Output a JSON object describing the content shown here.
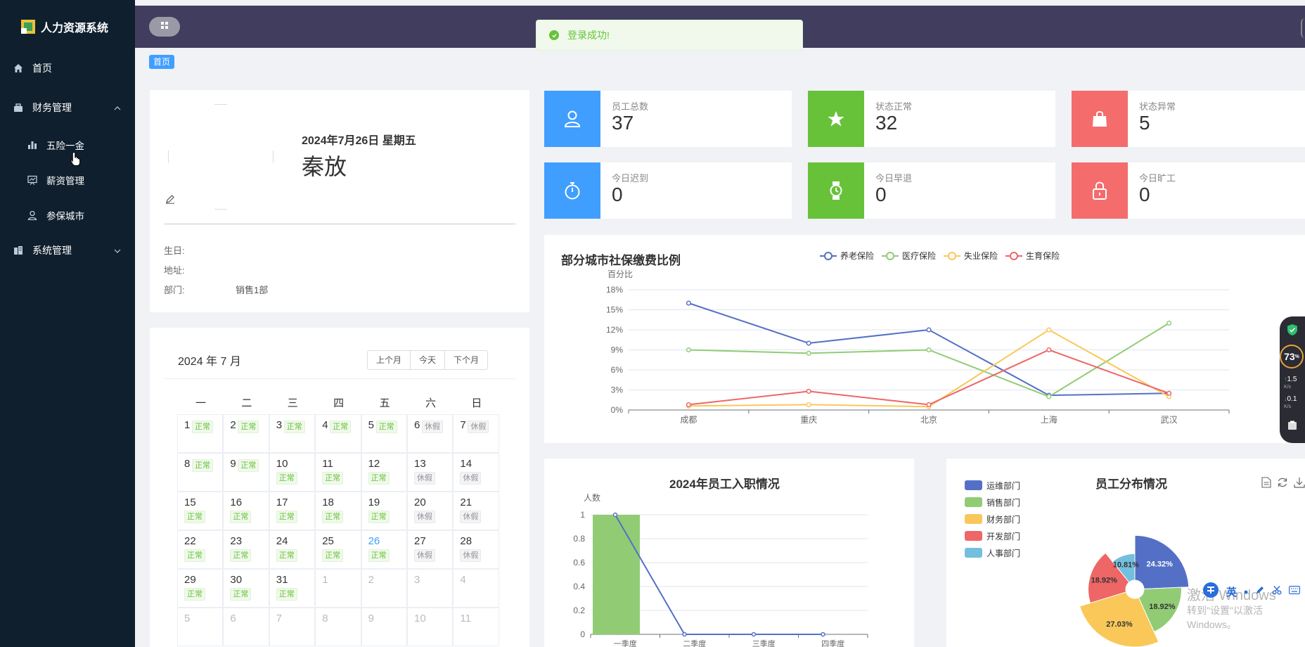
{
  "app": {
    "title": "人力资源系统"
  },
  "sidebar": {
    "items": [
      {
        "label": "首页",
        "icon": "home-icon"
      },
      {
        "label": "财务管理",
        "icon": "briefcase-icon"
      },
      {
        "label": "五险一金",
        "icon": "bar-chart-icon"
      },
      {
        "label": "薪资管理",
        "icon": "presentation-icon"
      },
      {
        "label": "参保城市",
        "icon": "person-icon"
      },
      {
        "label": "系统管理",
        "icon": "building-icon"
      }
    ]
  },
  "toast": {
    "message": "登录成功!"
  },
  "breadcrumb": {
    "label": "首页"
  },
  "profile": {
    "date": "2024年7月26日 星期五",
    "name": "秦放",
    "birthday_label": "生日:",
    "address_label": "地址:",
    "dept_label": "部门:",
    "dept_value": "销售1部"
  },
  "stats": [
    {
      "label": "员工总数",
      "value": "37",
      "color": "#409eff",
      "icon": "user-icon"
    },
    {
      "label": "状态正常",
      "value": "32",
      "color": "#67c23a",
      "icon": "star-icon"
    },
    {
      "label": "状态异常",
      "value": "5",
      "color": "#f56c6c",
      "icon": "bag-icon"
    },
    {
      "label": "今日迟到",
      "value": "0",
      "color": "#409eff",
      "icon": "stopwatch-icon"
    },
    {
      "label": "今日早退",
      "value": "0",
      "color": "#67c23a",
      "icon": "watch-icon"
    },
    {
      "label": "今日旷工",
      "value": "0",
      "color": "#f56c6c",
      "icon": "lock-icon"
    }
  ],
  "calendar": {
    "title": "2024 年 7 月",
    "buttons": [
      "上个月",
      "今天",
      "下个月"
    ],
    "weekdays": [
      "一",
      "二",
      "三",
      "四",
      "五",
      "六",
      "日"
    ],
    "days": [
      {
        "d": "1",
        "tag": "正常"
      },
      {
        "d": "2",
        "tag": "正常"
      },
      {
        "d": "3",
        "tag": "正常"
      },
      {
        "d": "4",
        "tag": "正常"
      },
      {
        "d": "5",
        "tag": "正常"
      },
      {
        "d": "6",
        "tag": "休假"
      },
      {
        "d": "7",
        "tag": "休假"
      },
      {
        "d": "8",
        "tag": "正常"
      },
      {
        "d": "9",
        "tag": "正常"
      },
      {
        "d": "10",
        "tag": "正常"
      },
      {
        "d": "11",
        "tag": "正常"
      },
      {
        "d": "12",
        "tag": "正常"
      },
      {
        "d": "13",
        "tag": "休假"
      },
      {
        "d": "14",
        "tag": "休假"
      },
      {
        "d": "15",
        "tag": "正常"
      },
      {
        "d": "16",
        "tag": "正常"
      },
      {
        "d": "17",
        "tag": "正常"
      },
      {
        "d": "18",
        "tag": "正常"
      },
      {
        "d": "19",
        "tag": "正常"
      },
      {
        "d": "20",
        "tag": "休假"
      },
      {
        "d": "21",
        "tag": "休假"
      },
      {
        "d": "22",
        "tag": "正常"
      },
      {
        "d": "23",
        "tag": "正常"
      },
      {
        "d": "24",
        "tag": "正常"
      },
      {
        "d": "25",
        "tag": "正常"
      },
      {
        "d": "26",
        "tag": "正常",
        "today": true
      },
      {
        "d": "27",
        "tag": "休假"
      },
      {
        "d": "28",
        "tag": "休假"
      },
      {
        "d": "29",
        "tag": "正常"
      },
      {
        "d": "30",
        "tag": "正常"
      },
      {
        "d": "31",
        "tag": "正常"
      },
      {
        "d": "1",
        "other": true
      },
      {
        "d": "2",
        "other": true
      },
      {
        "d": "3",
        "other": true
      },
      {
        "d": "4",
        "other": true
      },
      {
        "d": "5",
        "other": true
      },
      {
        "d": "6",
        "other": true
      },
      {
        "d": "7",
        "other": true
      },
      {
        "d": "8",
        "other": true
      },
      {
        "d": "9",
        "other": true
      },
      {
        "d": "10",
        "other": true
      },
      {
        "d": "11",
        "other": true
      }
    ]
  },
  "chart_data": [
    {
      "type": "line",
      "title": "部分城市社保缴费比例",
      "ylabel": "百分比",
      "categories": [
        "成都",
        "重庆",
        "北京",
        "上海",
        "武汉"
      ],
      "yticks": [
        "0%",
        "3%",
        "6%",
        "9%",
        "12%",
        "15%",
        "18%"
      ],
      "ylim": [
        0,
        18
      ],
      "series": [
        {
          "name": "养老保险",
          "color": "#5470c6",
          "values": [
            16,
            10,
            12,
            2.2,
            2.5
          ]
        },
        {
          "name": "医疗保险",
          "color": "#91cc75",
          "values": [
            9,
            8.5,
            9,
            2,
            13
          ]
        },
        {
          "name": "失业保险",
          "color": "#fac858",
          "values": [
            0.6,
            0.8,
            0.5,
            12,
            2
          ]
        },
        {
          "name": "生育保险",
          "color": "#ee6666",
          "values": [
            0.8,
            2.8,
            0.8,
            9,
            2.5
          ]
        }
      ],
      "legend": "top"
    },
    {
      "type": "bar",
      "title": "2024年员工入职情况",
      "ylabel": "人数",
      "categories": [
        "一季度",
        "二季度",
        "三季度",
        "四季度"
      ],
      "yticks": [
        "0",
        "0.2",
        "0.4",
        "0.6",
        "0.8",
        "1"
      ],
      "ylim": [
        0,
        1
      ],
      "series": [
        {
          "name": "bar",
          "color": "#91cc75",
          "values": [
            1,
            0,
            0,
            0
          ]
        },
        {
          "name": "line",
          "color": "#5470c6",
          "values": [
            1,
            0,
            0,
            0
          ]
        }
      ]
    },
    {
      "type": "pie",
      "title": "员工分布情况",
      "legend": "top-left",
      "slices": [
        {
          "name": "运维部门",
          "color": "#5470c6",
          "value": 24.32
        },
        {
          "name": "销售部门",
          "color": "#91cc75",
          "value": 18.92
        },
        {
          "name": "财务部门",
          "color": "#fac858",
          "value": 27.03
        },
        {
          "name": "开发部门",
          "color": "#ee6666",
          "value": 18.92
        },
        {
          "name": "人事部门",
          "color": "#73c0de",
          "value": 10.81
        }
      ],
      "labels": [
        "24.32%",
        "18.92%",
        "27.03%",
        "18.92%",
        "10.81%"
      ]
    }
  ],
  "overlay": {
    "widget_value": "73",
    "widget_unit": "%",
    "up_speed": "1.5",
    "down_speed": "0.1",
    "speed_unit": "K/s",
    "ime_label": "英",
    "watermark_line1": "激活 Windows",
    "watermark_line2": "转到\"设置\"以激活 Windows。"
  }
}
